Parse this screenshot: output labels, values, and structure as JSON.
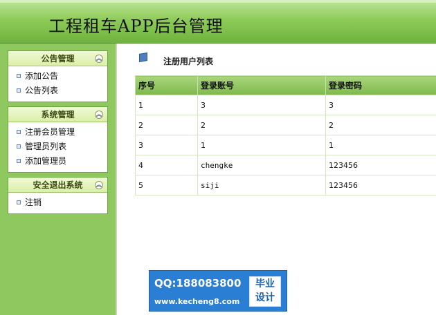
{
  "header": {
    "title": "工程租车APP后台管理"
  },
  "sidebar": {
    "groups": [
      {
        "title": "公告管理",
        "items": [
          "添加公告",
          "公告列表"
        ]
      },
      {
        "title": "系统管理",
        "items": [
          "注册会员管理",
          "管理员列表",
          "添加管理员"
        ]
      },
      {
        "title": "安全退出系统",
        "items": [
          "注销"
        ]
      }
    ],
    "collapse_icon": "chevron-up-icon",
    "bullet_icon": "bullet-square-icon"
  },
  "main": {
    "title": "注册用户列表",
    "title_icon": "document-edit-icon",
    "table": {
      "headers": [
        "序号",
        "登录账号",
        "登录密码"
      ],
      "rows": [
        [
          "1",
          "3",
          "3"
        ],
        [
          "2",
          "2",
          "2"
        ],
        [
          "3",
          "1",
          "1"
        ],
        [
          "4",
          "chengke",
          "123456"
        ],
        [
          "5",
          "siji",
          "123456"
        ]
      ]
    }
  },
  "watermark": {
    "qq": "QQ:188083800",
    "url": "www.kecheng8.com",
    "badge_line1": "毕业",
    "badge_line2": "设计"
  },
  "colors": {
    "header_green": "#8fcc5a",
    "sidebar_green": "#8fc85e",
    "table_header_green": "#7fb84d",
    "badge_blue": "#2a7fd4"
  }
}
